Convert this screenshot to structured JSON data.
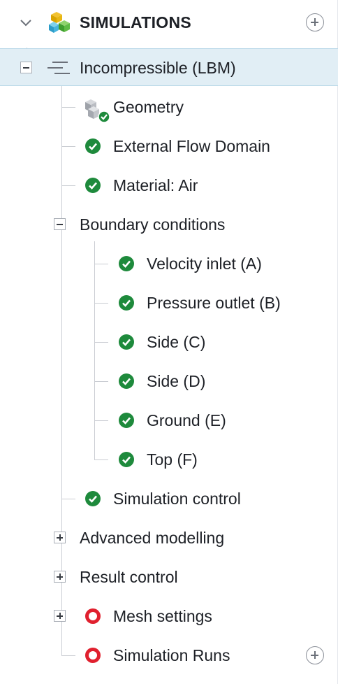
{
  "header": {
    "title": "SIMULATIONS"
  },
  "tree": {
    "root": {
      "label": "Incompressible (LBM)"
    },
    "geometry": {
      "label": "Geometry"
    },
    "external_flow": {
      "label": "External Flow Domain"
    },
    "material": {
      "label": "Material: Air"
    },
    "boundary": {
      "label": "Boundary conditions",
      "items": [
        {
          "label": "Velocity inlet (A)"
        },
        {
          "label": "Pressure outlet (B)"
        },
        {
          "label": "Side (C)"
        },
        {
          "label": "Side (D)"
        },
        {
          "label": "Ground (E)"
        },
        {
          "label": "Top (F)"
        }
      ]
    },
    "simulation_control": {
      "label": "Simulation control"
    },
    "advanced_modelling": {
      "label": "Advanced modelling"
    },
    "result_control": {
      "label": "Result control"
    },
    "mesh_settings": {
      "label": "Mesh settings"
    },
    "simulation_runs": {
      "label": "Simulation Runs"
    }
  },
  "colors": {
    "check_green": "#1e8a3c",
    "warning_red": "#e0202e",
    "selection_bg": "#e1eef5"
  },
  "icons": {
    "header_toggle": "chevron-down-icon",
    "header_logo": "simulation-cubes-icon",
    "header_add": "add-circle-icon",
    "root": "simulation-type-icon",
    "geometry": "geometry-check-icon",
    "valid": "check-circle-icon",
    "invalid": "error-ring-icon"
  }
}
